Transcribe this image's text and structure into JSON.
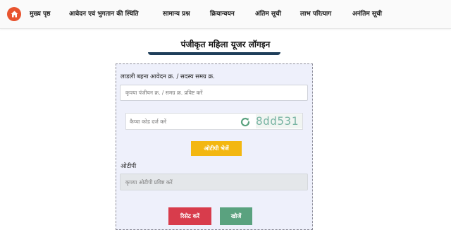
{
  "nav": {
    "home_icon": "home-icon",
    "items": [
      "मुख्य पृष्ठ",
      "आवेदन एवं भुगतान की स्थिति",
      "सामान्य प्रश्न",
      "क्रियान्वयन",
      "अंतिम सूची",
      "लाभ परित्याग",
      "अनंतिम सूची"
    ]
  },
  "page": {
    "title": "पंजीकृत महिला यूजर लॉगइन"
  },
  "form": {
    "id_label": "लाडली बहना आवेदन क्र. / सदस्य समग्र क्र.",
    "id_placeholder": "कृपया पंजीयन क्र. / समग्र क्र. प्रविष्ट करें",
    "captcha_placeholder": "कैप्चा कोड दर्ज करें",
    "captcha_code": "8dd531",
    "otp_button": "ओटीपी भेजें",
    "otp_label": "ओटीपी",
    "otp_placeholder": "कृपया ओटीपी प्रविष्ट करें",
    "reset_button": "रिसेट करें",
    "search_button": "खोजें"
  },
  "colors": {
    "accent_home": "#e8542f",
    "otp_button": "#f3b711",
    "reset_button": "#d83c4c",
    "search_button": "#5aa27f",
    "captcha_text": "#7ab5a4",
    "title_underline": "#1f3e5a"
  }
}
